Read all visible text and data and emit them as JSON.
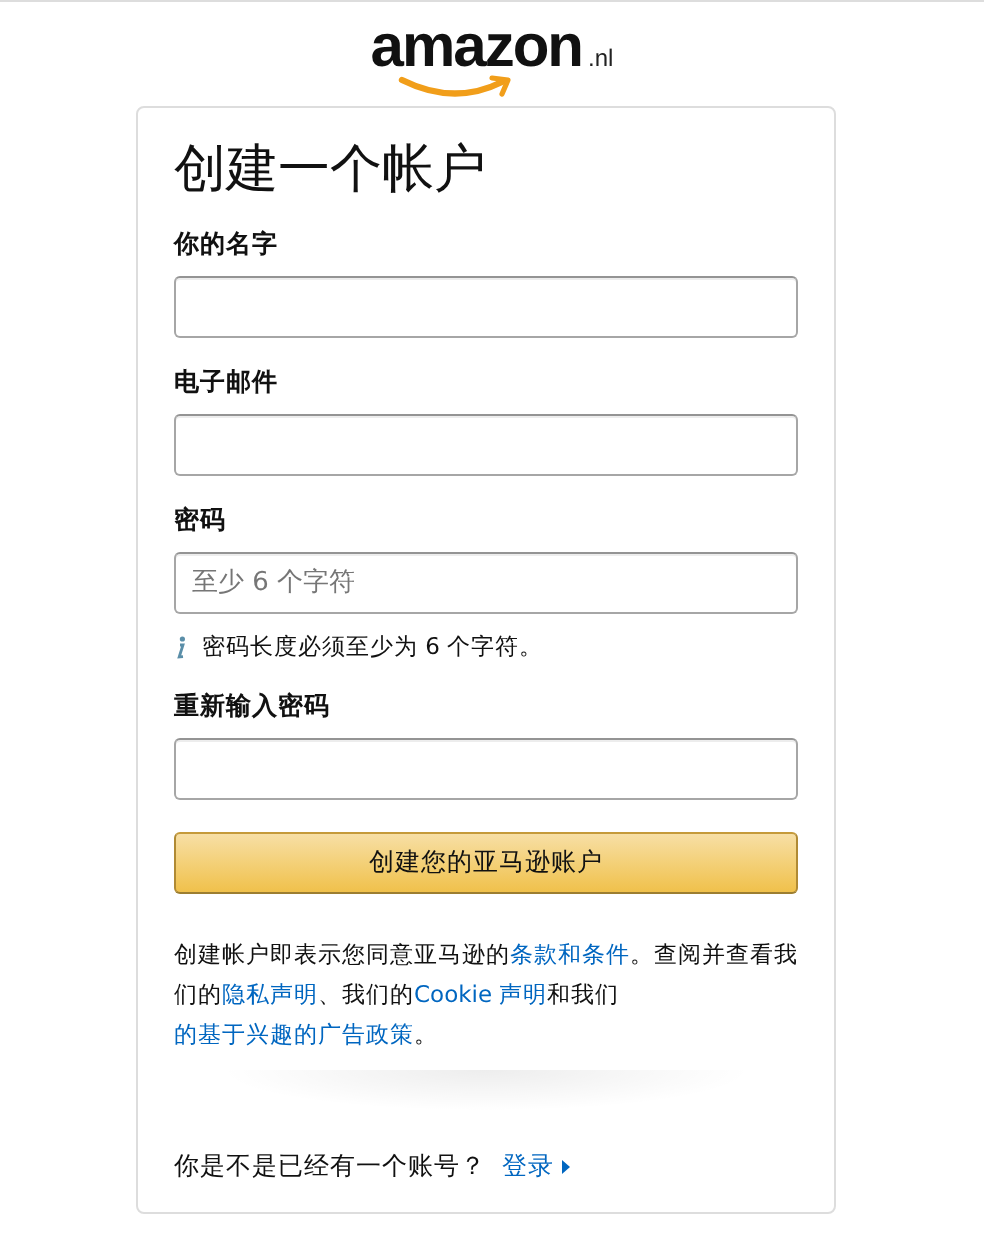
{
  "logo": {
    "wordmark": "amazon",
    "suffix": ".nl"
  },
  "title": "创建一个帐户",
  "fields": [
    {
      "label": "你的名字"
    },
    {
      "label": "电子邮件"
    },
    {
      "label": "密码",
      "placeholder": "至少 6 个字符",
      "hint": "密码长度必须至少为 6 个字符。"
    },
    {
      "label": "重新输入密码"
    }
  ],
  "submit": "创建您的亚马逊账户",
  "legal": [
    {
      "kind": "text",
      "text": "创建帐户即表示您同意亚马逊的"
    },
    {
      "kind": "link",
      "text": "条款和条件"
    },
    {
      "kind": "text",
      "text": "。查阅并查看我们的"
    },
    {
      "kind": "link",
      "text": "隐私声明"
    },
    {
      "kind": "text",
      "text": "、我们的"
    },
    {
      "kind": "link",
      "text": "Cookie 声明"
    },
    {
      "kind": "text",
      "text": "和我们"
    },
    {
      "kind": "link",
      "text": "的基于兴趣的广告政策"
    },
    {
      "kind": "text",
      "text": "。"
    }
  ],
  "signin": {
    "question": "你是不是已经有一个账号？",
    "link": "登录"
  }
}
